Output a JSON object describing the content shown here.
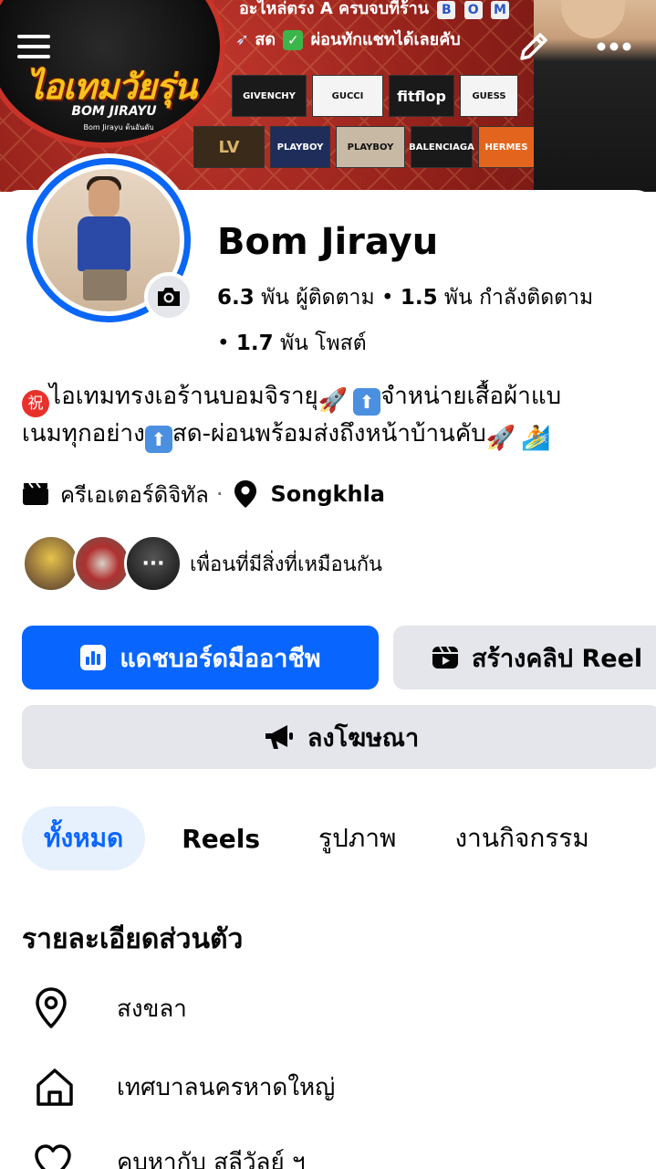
{
  "cover": {
    "logo_text": "ไอเทมวัยรุ่น",
    "logo_sub": "BOM JIRAYU",
    "logo_handle": "Bom Jirayu  ต้นอันดับ",
    "headline": "อะไหล่ตรง A ครบจบที่ร้าน",
    "headline_letters": [
      "B",
      "O",
      "M"
    ],
    "line2_prefix": "สด",
    "line2_text": "ผ่อนทักแชทได้เลยคับ",
    "brands": [
      "GIVENCHY",
      "GUCCI",
      "fitflop",
      "GUESS",
      "LV",
      "PLAYBOY",
      "PLAYBOY",
      "BALENCIAGA",
      "HERMES"
    ]
  },
  "top_bar": {
    "menu_icon": "hamburger-icon",
    "edit_icon": "pencil-icon",
    "more_icon": "more-dots-icon"
  },
  "profile": {
    "name": "Bom Jirayu",
    "followers_count": "6.3",
    "followers_label": "พัน ผู้ติดตาม",
    "following_count": "1.5",
    "following_label": "พัน กำลังติดตาม",
    "posts_count": "1.7",
    "posts_label": "พัน โพสต์",
    "bio_line1_a": "ไอเทมทรงเอร้านบอมจิรายุ",
    "bio_line1_b": "จำหน่ายเสื้อผ้าแบ",
    "bio_line2_a": "เนมทุกอย่าง",
    "bio_line2_b": "สด-ผ่อนพร้อมส่งถึงหน้าบ้านคับ",
    "badge_char": "祝",
    "category": "ครีเอเตอร์ดิจิทัล",
    "location": "Songkhla",
    "mutual_text": "เพื่อนที่มีสิ่งที่เหมือนกัน"
  },
  "buttons": {
    "dashboard": "แดชบอร์ดมืออาชีพ",
    "create_reel": "สร้างคลิป Reel",
    "advertise": "ลงโฆษณา"
  },
  "tabs": [
    {
      "label": "ทั้งหมด",
      "active": true
    },
    {
      "label": "Reels",
      "active": false
    },
    {
      "label": "รูปภาพ",
      "active": false
    },
    {
      "label": "งานกิจกรรม",
      "active": false
    }
  ],
  "details": {
    "title": "รายละเอียดส่วนตัว",
    "items": [
      {
        "icon": "location-pin-icon",
        "text": "สงขลา"
      },
      {
        "icon": "home-icon",
        "text": "เทศบาลนครหาดใหญ่"
      },
      {
        "icon": "heart-icon",
        "text": "คบหากับ สลีวัลย์ ฯ"
      }
    ]
  },
  "colors": {
    "primary": "#0866ff",
    "secondary_button": "#e4e6eb",
    "story_ring": "#0a66f5",
    "active_tab_bg": "#e7f0fd"
  }
}
